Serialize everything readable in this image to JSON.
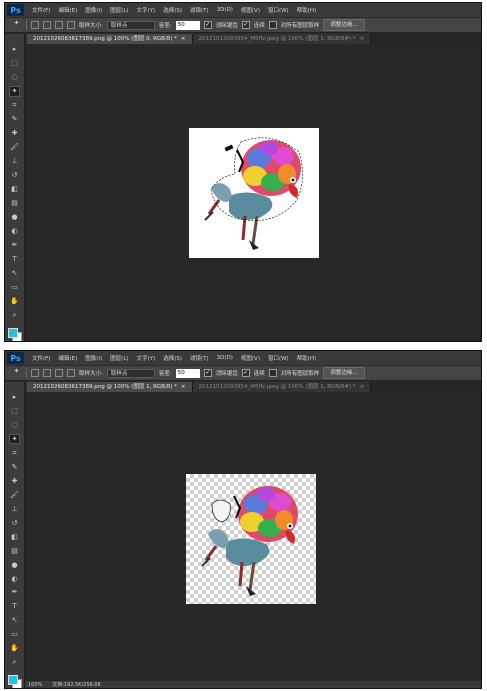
{
  "app": {
    "logo": "Ps"
  },
  "menu": [
    "文件(F)",
    "编辑(E)",
    "图像(I)",
    "图层(L)",
    "文字(Y)",
    "选择(S)",
    "滤镜(T)",
    "3D(D)",
    "视图(V)",
    "窗口(W)",
    "帮助(H)"
  ],
  "options": {
    "sample_size_label": "取样大小:",
    "sample_size_value": "取样点",
    "tolerance_label": "容差:",
    "tolerance_value": "50",
    "antialias_label": "消除锯齿",
    "contiguous_label": "连续",
    "all_layers_label": "对所有图层取样",
    "refine_edge_button": "调整边缘..."
  },
  "screen1": {
    "tabs": [
      {
        "label": "20121026083617389.png @ 100% (图层 0, RGB/8) *",
        "close": "×"
      },
      {
        "label": "20121012093954_M5ffz.jpeg @ 100% (图层 1, RGB/8#) *",
        "close": "×"
      }
    ],
    "status": null
  },
  "screen2": {
    "tabs": [
      {
        "label": "20121026083617389.png @ 100% (图层 1, RGB/8) *",
        "close": "×"
      },
      {
        "label": "20121012093954_M5ffz.jpeg @ 100% (图层 1, RGB/8#) *",
        "close": "×"
      }
    ],
    "status": {
      "zoom": "100%",
      "doc": "文档:192.5K/256.0K"
    }
  },
  "tools": [
    "move-tool",
    "marquee-tool",
    "lasso-tool",
    "magic-wand-tool",
    "crop-tool",
    "eyedropper-tool",
    "healing-brush-tool",
    "brush-tool",
    "clone-stamp-tool",
    "history-brush-tool",
    "eraser-tool",
    "gradient-tool",
    "blur-tool",
    "dodge-tool",
    "pen-tool",
    "type-tool",
    "path-selection-tool",
    "shape-tool",
    "hand-tool",
    "zoom-tool"
  ],
  "tool_glyphs": [
    "▸",
    "⬚",
    "◌",
    "✦",
    "⌗",
    "✎",
    "✚",
    "🖌",
    "⊥",
    "↺",
    "◧",
    "▤",
    "●",
    "◐",
    "✒",
    "T",
    "↖",
    "▭",
    "✋",
    "⌕"
  ],
  "colors": {
    "foreground": "#2cc0d6",
    "background": "#ffffff"
  }
}
